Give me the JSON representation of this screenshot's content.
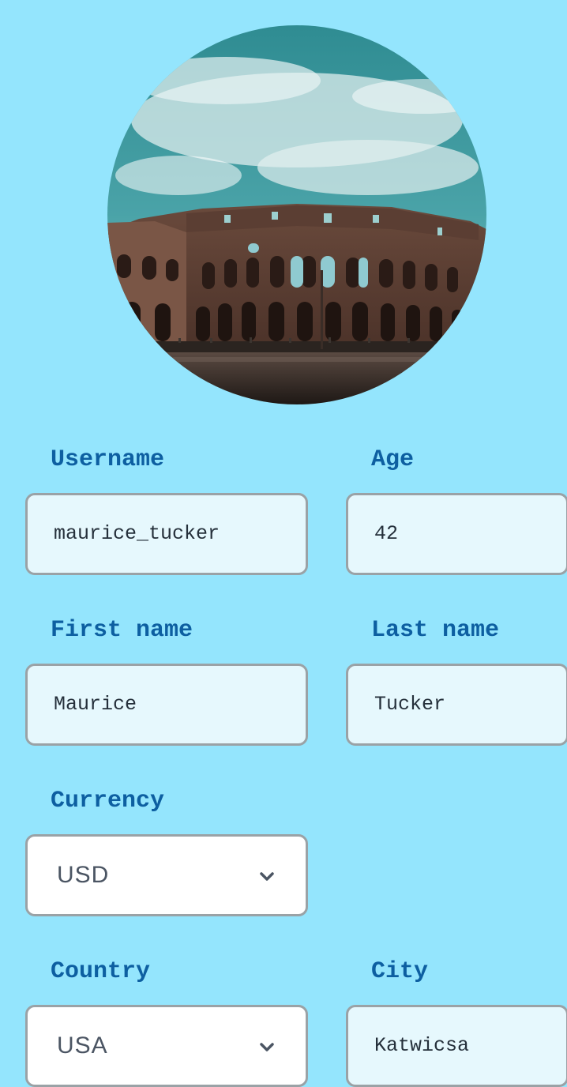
{
  "profile": {
    "avatar_icon": "profile-photo"
  },
  "form": {
    "username": {
      "label": "Username",
      "value": "maurice_tucker"
    },
    "age": {
      "label": "Age",
      "value": "42"
    },
    "first_name": {
      "label": "First name",
      "value": "Maurice"
    },
    "last_name": {
      "label": "Last name",
      "value": "Tucker"
    },
    "currency": {
      "label": "Currency",
      "selected": "USD"
    },
    "country": {
      "label": "Country",
      "selected": "USA"
    },
    "city": {
      "label": "City",
      "value": "Katwicsa"
    }
  },
  "colors": {
    "background": "#94e5fd",
    "label": "#0d5fa1",
    "input_bg": "#e6f8fd",
    "border": "#9aa2a6"
  }
}
